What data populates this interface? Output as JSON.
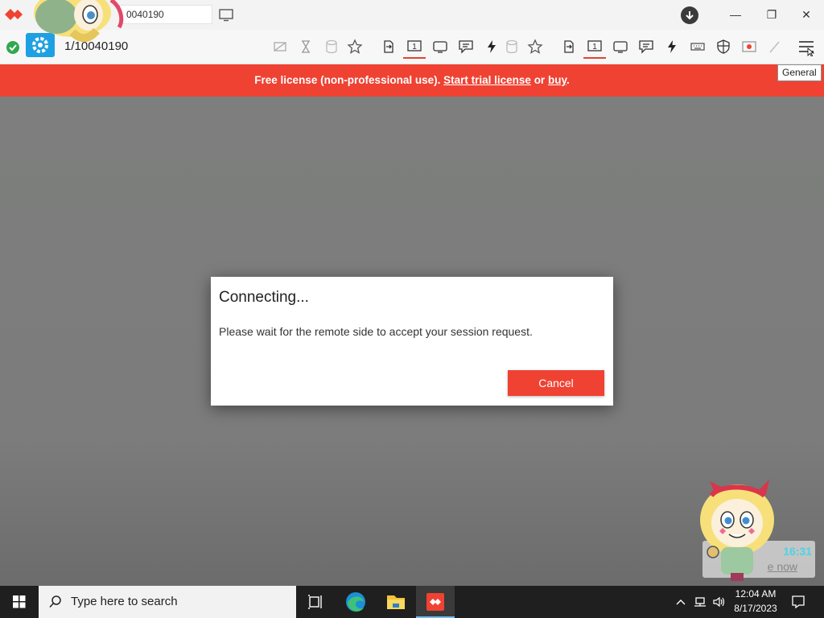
{
  "titlebar": {
    "tab_address": "0040190",
    "window_controls": {
      "minimize": "—",
      "restore": "❐",
      "close": "✕"
    }
  },
  "toolbar": {
    "address": "1/10040190",
    "icons": [
      "privacy-mode-icon",
      "hourglass-icon",
      "database-icon",
      "star-icon",
      "switch-side-icon",
      "monitor-1-icon",
      "display-icon",
      "chat-icon",
      "actions-icon",
      "database-icon",
      "star-icon",
      "switch-side-icon",
      "monitor-1-icon",
      "display-icon",
      "chat-icon",
      "actions-icon",
      "keyboard-icon",
      "shield-icon",
      "record-icon",
      "pen-icon",
      "menu-icon"
    ],
    "monitor_number": "1"
  },
  "tooltip": {
    "text": "General"
  },
  "license_banner": {
    "prefix": "Free license (non-professional use).",
    "trial_link": "Start trial license",
    "middle": "or",
    "buy_link": "buy",
    "suffix": "."
  },
  "dialog": {
    "title": "Connecting...",
    "message": "Please wait for the remote side to accept your session request.",
    "cancel_label": "Cancel"
  },
  "overlay_widget": {
    "time": "16:31",
    "link": "e now"
  },
  "taskbar": {
    "search_placeholder": "Type here to search",
    "clock_time": "12:04 AM",
    "clock_date": "8/17/2023"
  },
  "colors": {
    "accent_red": "#ef4233",
    "status_green": "#2fa84f",
    "gear_blue": "#1fa0e2",
    "remote_bg": "#7d7e7d"
  }
}
